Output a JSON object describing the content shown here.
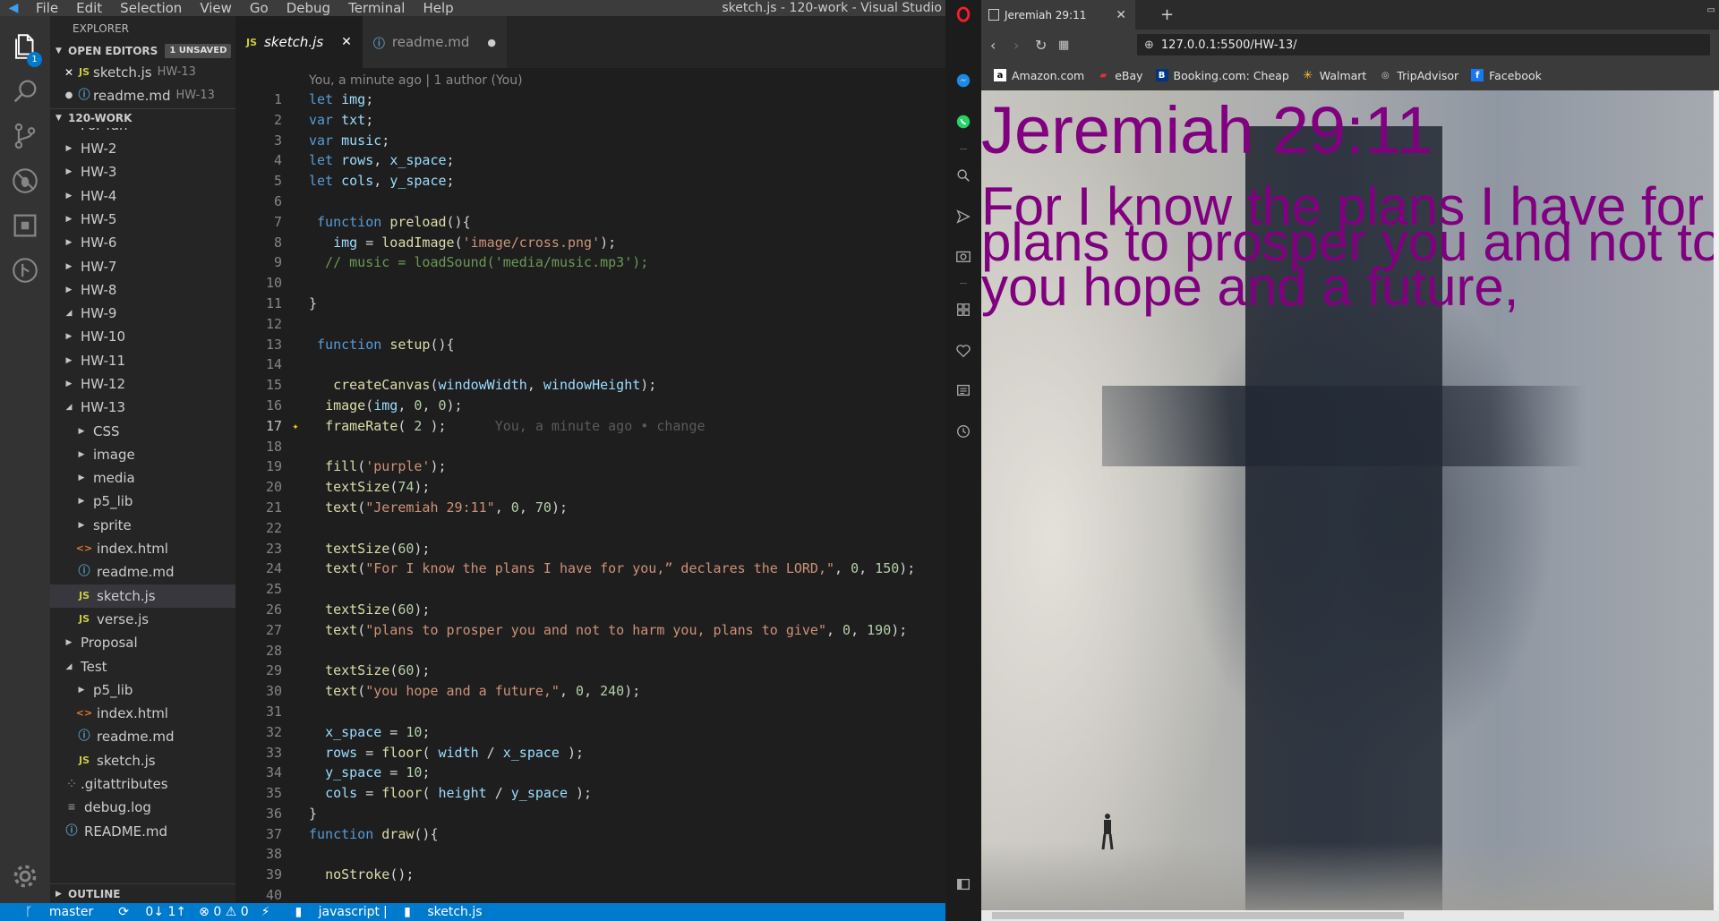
{
  "vscode": {
    "menu": [
      "File",
      "Edit",
      "Selection",
      "View",
      "Go",
      "Debug",
      "Terminal",
      "Help"
    ],
    "window_title": "sketch.js - 120-work - Visual Studio",
    "activity_badge": "1",
    "explorer_title": "EXPLORER",
    "open_editors": {
      "label": "OPEN EDITORS",
      "unsaved": "1 UNSAVED",
      "items": [
        {
          "name": "sketch.js",
          "folder": "HW-13"
        },
        {
          "name": "readme.md",
          "folder": "HW-13"
        }
      ]
    },
    "workspace": {
      "label": "120-WORK",
      "rows": [
        "For fun",
        "HW-2",
        "HW-3",
        "HW-4",
        "HW-5",
        "HW-6",
        "HW-7",
        "HW-8",
        "HW-9",
        "HW-10",
        "HW-11",
        "HW-12",
        "HW-13",
        "CSS",
        "image",
        "media",
        "p5_lib",
        "sprite",
        "index.html",
        "readme.md",
        "sketch.js",
        "verse.js",
        "Proposal",
        "Test",
        "p5_lib",
        "index.html",
        "readme.md",
        "sketch.js",
        ".gitattributes",
        "debug.log",
        "README.md"
      ]
    },
    "outline_label": "OUTLINE",
    "tabs": [
      {
        "label": "sketch.js"
      },
      {
        "label": "readme.md"
      }
    ],
    "blame_header": "You, a minute ago | 1 author (You)",
    "inline_blame": "You, a minute ago • change",
    "code_lines": [
      "let img;",
      "var txt;",
      "var music;",
      "let rows, x_space;",
      "let cols, y_space;",
      "",
      " function preload(){",
      "   img = loadImage('image/cross.png');",
      "  // music = loadSound('media/music.mp3');",
      "",
      "}",
      "",
      " function setup(){",
      "",
      "   createCanvas(windowWidth, windowHeight);",
      "  image(img, 0, 0);",
      "  frameRate( 2 );",
      "",
      "  fill('purple');",
      "  textSize(74);",
      "  text(\"Jeremiah 29:11\", 0, 70);",
      "",
      "  textSize(60);",
      "  text(\"For I know the plans I have for you,” declares the LORD,\", 0, 150);",
      "",
      "  textSize(60);",
      "  text(\"plans to prosper you and not to harm you, plans to give\", 0, 190);",
      "",
      "  textSize(60);",
      "  text(\"you hope and a future,\", 0, 240);",
      "",
      "  x_space = 10;",
      "  rows = floor( width / x_space );",
      "  y_space = 10;",
      "  cols = floor( height / y_space );",
      "}",
      "function draw(){",
      "",
      "  noStroke();",
      ""
    ],
    "status": {
      "branch": "master",
      "sync": "0↓ 1↑",
      "problems": "⊗ 0 ⚠ 0",
      "language": "javascript",
      "file": "sketch.js"
    }
  },
  "browser": {
    "tab_title": "Jeremiah 29:11",
    "url": "127.0.0.1:5500/HW-13/",
    "bookmarks": [
      "Amazon.com",
      "eBay",
      "Booking.com: Cheap",
      "Walmart",
      "TripAdvisor",
      "Facebook"
    ],
    "canvas_text": {
      "title": "Jeremiah 29:11",
      "line1": "For I know the plans I have for you,” declares the LORD,",
      "line2": "plans to prosper you and not to harm you, plans to give",
      "line3": "you hope and a future,"
    },
    "text_color": "#800080"
  }
}
